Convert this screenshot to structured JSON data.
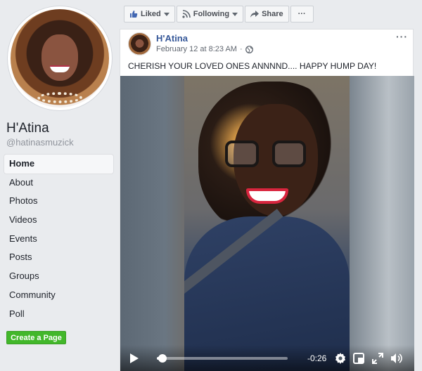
{
  "sidebar": {
    "page_name": "H'Atina",
    "handle": "@hatinasmuzick",
    "nav": [
      {
        "label": "Home",
        "active": true
      },
      {
        "label": "About"
      },
      {
        "label": "Photos"
      },
      {
        "label": "Videos"
      },
      {
        "label": "Events"
      },
      {
        "label": "Posts"
      },
      {
        "label": "Groups"
      },
      {
        "label": "Community"
      },
      {
        "label": "Poll"
      }
    ],
    "create_page_label": "Create a Page"
  },
  "actionbar": {
    "liked_label": "Liked",
    "following_label": "Following",
    "share_label": "Share",
    "more_label": "···"
  },
  "post": {
    "author": "H'Atina",
    "date": "February 12 at 8:23 AM",
    "separator": "·",
    "privacy_icon": "globe-icon",
    "more_label": "···",
    "text": "CHERISH YOUR LOVED ONES ANNNND.... HAPPY HUMP DAY!"
  },
  "video": {
    "time_remaining": "-0:26",
    "progress": 0.03,
    "icons": [
      "play-icon",
      "gear-icon",
      "pip-icon",
      "fullscreen-icon",
      "volume-icon"
    ]
  },
  "colors": {
    "link_blue": "#365899",
    "create_green": "#42b72a",
    "page_bg": "#e9ebee"
  }
}
